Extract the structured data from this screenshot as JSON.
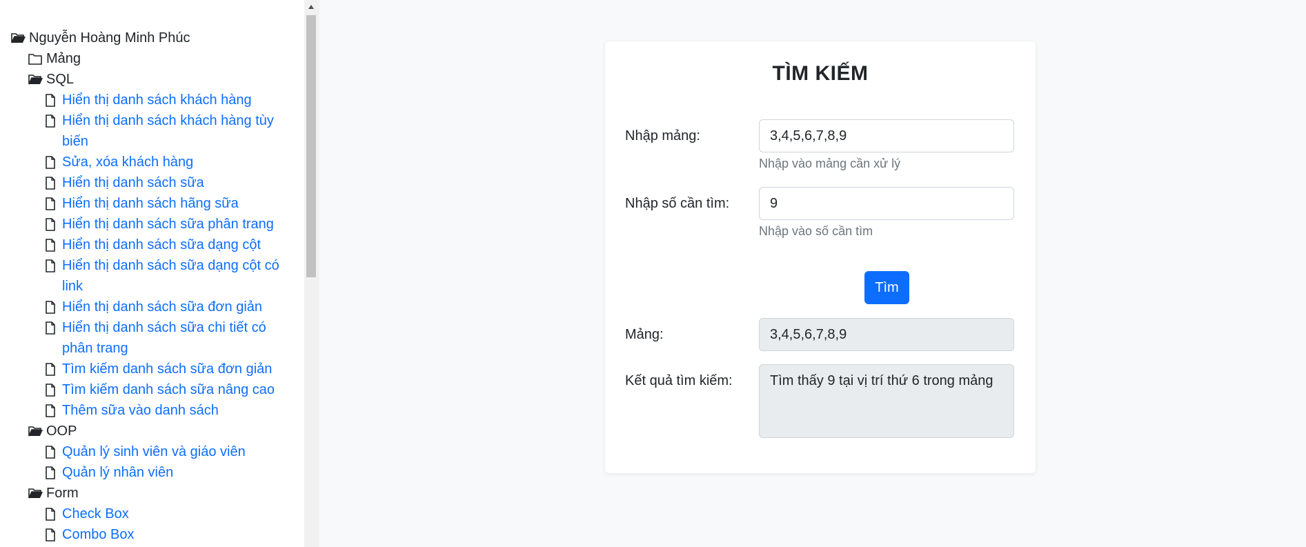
{
  "sidebar": {
    "root": "Nguyễn Hoàng Minh Phúc",
    "folders": {
      "mang": "Mảng",
      "sql": "SQL",
      "oop": "OOP",
      "form": "Form"
    },
    "sql_items": [
      "Hiển thị danh sách khách hàng",
      "Hiển thị danh sách khách hàng tùy biến",
      "Sửa, xóa khách hàng",
      "Hiển thị danh sách sữa",
      "Hiển thị danh sách hãng sữa",
      "Hiển thị danh sách sữa phân trang",
      "Hiển thị danh sách sữa dạng cột",
      "Hiển thị danh sách sữa dạng cột có link",
      "Hiển thị danh sách sữa đơn giản",
      "Hiển thị danh sách sữa chi tiết có phân trang",
      "Tìm kiếm danh sách sữa đơn giản",
      "Tìm kiếm danh sách sữa nâng cao",
      "Thêm sữa vào danh sách"
    ],
    "oop_items": [
      "Quản lý sinh viên và giáo viên",
      "Quản lý nhân viên"
    ],
    "form_items": [
      "Check Box",
      "Combo Box"
    ]
  },
  "main": {
    "title": "TÌM KIẾM",
    "array_label": "Nhập mảng:",
    "array_value": "3,4,5,6,7,8,9",
    "array_help": "Nhập vào mảng cần xử lý",
    "number_label": "Nhập số cần tìm:",
    "number_value": "9",
    "number_help": "Nhập vào số cần tìm",
    "button_label": "Tìm",
    "result_array_label": "Mảng:",
    "result_array_value": "3,4,5,6,7,8,9",
    "result_label": "Kết quả tìm kiếm:",
    "result_value": "Tìm thấy 9 tại vị trí thứ 6 trong mảng"
  },
  "colors": {
    "link": "#0d6efd",
    "button": "#0d6efd",
    "readonly_bg": "#e9ecef"
  }
}
